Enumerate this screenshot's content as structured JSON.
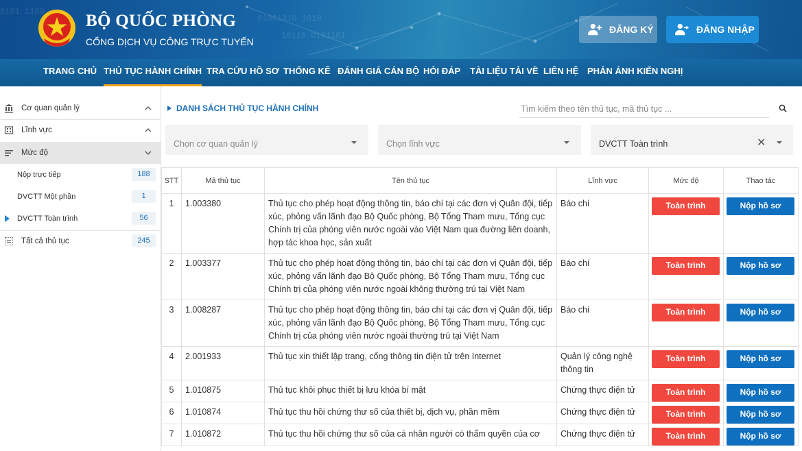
{
  "header": {
    "title": "BỘ QUỐC PHÒNG",
    "subtitle": "CỔNG DỊCH VỤ CÔNG TRỰC TUYẾN",
    "register_label": "ĐĂNG KÝ",
    "login_label": "ĐĂNG NHẬP",
    "bg_color": "#1767a8"
  },
  "nav": {
    "items": [
      "TRANG CHỦ",
      "THỦ TỤC HÀNH CHÍNH",
      "TRA CỨU HỒ SƠ",
      "THỐNG KÊ",
      "ĐÁNH GIÁ CÁN BỘ",
      "HỎI ĐÁP",
      "TÀI LIỆU TẢI VỀ",
      "LIÊN HỆ",
      "PHẢN ÁNH KIẾN NGHỊ"
    ],
    "active": "THỦ TỤC HÀNH CHÍNH",
    "active_color": "#f3a51c"
  },
  "sidebar": {
    "agency": "Cơ quan quản lý",
    "field": "Lĩnh vực",
    "level": "Mức độ",
    "levels": [
      {
        "label": "Nộp trực tiếp",
        "count": "188"
      },
      {
        "label": "DVCTT Một phần",
        "count": "1"
      },
      {
        "label": "DVCTT Toàn trình",
        "count": "56"
      }
    ],
    "all_label": "Tất cả thủ tục",
    "all_count": "245",
    "selected_level": "DVCTT Toàn trình"
  },
  "main": {
    "title": "DANH SÁCH THỦ TỤC HÀNH CHÍNH",
    "search_placeholder": "Tìm kiếm theo tên thủ tục, mã thủ tục ...",
    "filter_agency_placeholder": "Chọn cơ quan quản lý",
    "filter_field_placeholder": "Chọn lĩnh vực",
    "filter_level_value": "DVCTT Toàn trình"
  },
  "table": {
    "headers": [
      "STT",
      "Mã thủ tục",
      "Tên thủ tục",
      "Lĩnh vực",
      "Mức độ",
      "Thao tác"
    ],
    "rows": [
      {
        "stt": "1",
        "code": "1.003380",
        "name": "Thủ tục cho phép hoạt động thông tin, báo chí tại các đơn vị Quân đội, tiếp xúc, phỏng vấn lãnh đạo Bộ Quốc phòng, Bộ Tổng Tham mưu, Tổng cục Chính trị của phóng viên nước ngoài vào Việt Nam qua đường liên doanh, hợp tác khoa học, sản xuất",
        "field": "Báo chí",
        "level": "Toàn trình",
        "action": "Nộp hồ sơ"
      },
      {
        "stt": "2",
        "code": "1.003377",
        "name": "Thủ tục cho phép hoạt động thông tin, báo chí tại các đơn vị Quân đội, tiếp xúc, phỏng vấn lãnh đạo Bộ Quốc phòng, Bộ Tổng Tham mưu, Tổng cục Chính trị của phóng viên nước ngoài không thường trú tại Việt Nam",
        "field": "Báo chí",
        "level": "Toàn trình",
        "action": "Nộp hồ sơ"
      },
      {
        "stt": "3",
        "code": "1.008287",
        "name": "Thủ tục cho phép hoạt động thông tin, báo chí tại các đơn vị Quân đội, tiếp xúc, phỏng vấn lãnh đạo Bộ Quốc phòng, Bộ Tổng Tham mưu, Tổng cục Chính trị của phóng viên nước ngoài thường trú tại Việt Nam",
        "field": "Báo chí",
        "level": "Toàn trình",
        "action": "Nộp hồ sơ"
      },
      {
        "stt": "4",
        "code": "2.001933",
        "name": "Thủ tục xin thiết lập trang, cổng thông tin điện tử trên Internet",
        "field": "Quản lý công nghệ thông tin",
        "level": "Toàn trình",
        "action": "Nộp hồ sơ"
      },
      {
        "stt": "5",
        "code": "1.010875",
        "name": "Thủ tục khôi phục thiết bị lưu khóa bí mật",
        "field": "Chứng thực điện tử",
        "level": "Toàn trình",
        "action": "Nộp hồ sơ"
      },
      {
        "stt": "6",
        "code": "1.010874",
        "name": "Thủ tục thu hồi chứng thư số của thiết bị, dịch vụ, phần mềm",
        "field": "Chứng thực điện tử",
        "level": "Toàn trình",
        "action": "Nộp hồ sơ"
      },
      {
        "stt": "7",
        "code": "1.010872",
        "name": "Thủ tục thu hồi chứng thư số của cá nhân người có thẩm quyền của cơ",
        "field": "Chứng thực điện tử",
        "level": "Toàn trình",
        "action": "Nộp hồ sơ"
      }
    ],
    "level_btn_color": "#f0483e",
    "action_btn_color": "#0f70c0"
  }
}
